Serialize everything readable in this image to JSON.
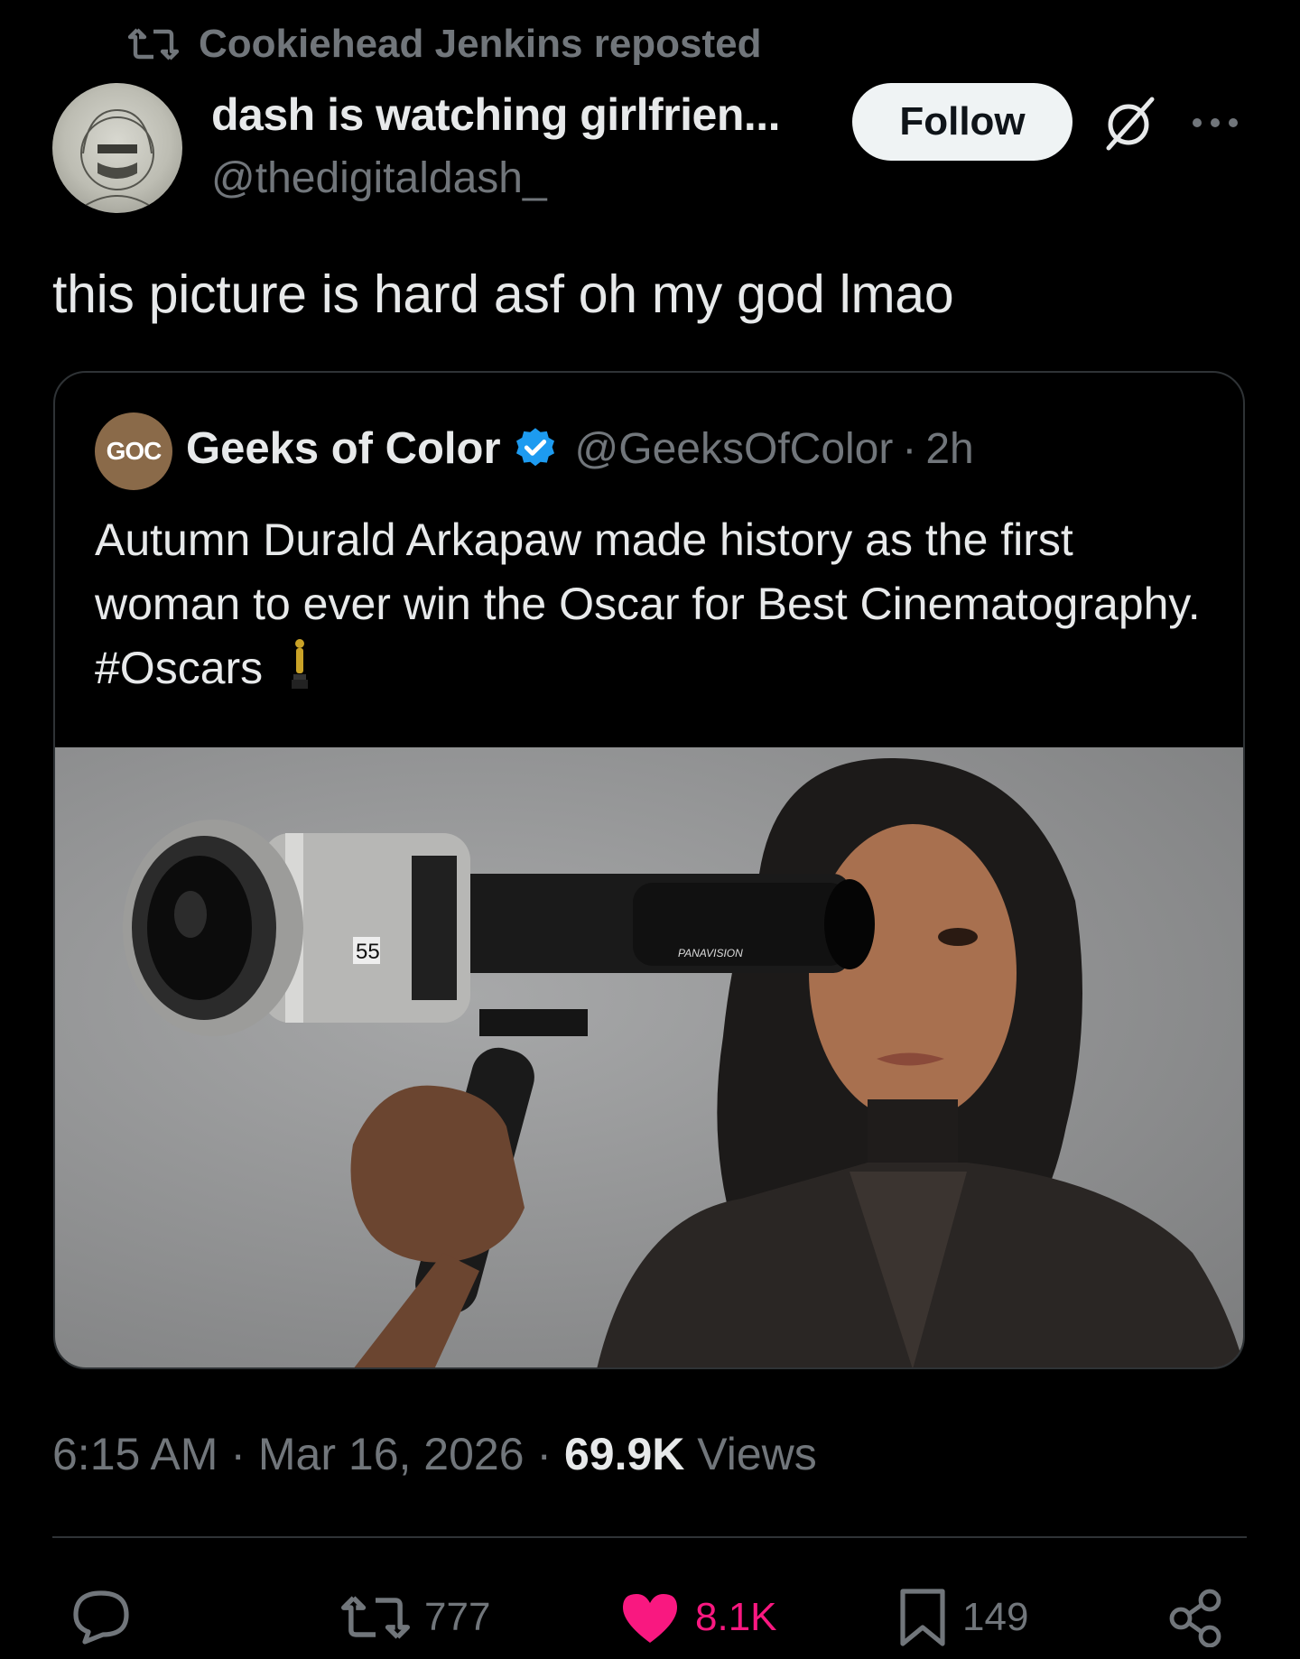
{
  "repost": {
    "icon": "repost-icon",
    "text": "Cookiehead Jenkins reposted"
  },
  "author": {
    "name": "dash is watching girlfrien...",
    "handle": "@thedigitaldash_",
    "follow_label": "Follow",
    "icons": [
      "grok-icon",
      "more-icon"
    ]
  },
  "tweet": {
    "text": "this picture is hard asf oh my god lmao"
  },
  "quoted": {
    "avatar_text": "GOC",
    "name": "Geeks of Color",
    "verified": true,
    "handle": "@GeeksOfColor",
    "separator": "·",
    "time": "2h",
    "text": "Autumn Durald Arkapaw made history as the first woman to ever win the Oscar for Best Cinematography. #Oscars",
    "emoji": "oscar-trophy-emoji",
    "image_lens_number": "55",
    "image_lens_brand": "PANAVISION"
  },
  "meta": {
    "time": "6:15 AM",
    "sep1": " · ",
    "date": "Mar 16, 2026",
    "sep2": " · ",
    "views_count": "69.9K",
    "views_label": " Views"
  },
  "actions": {
    "reply_count": "",
    "repost_count": "777",
    "like_count": "8.1K",
    "bookmark_count": "149"
  },
  "colors": {
    "background": "#000000",
    "text": "#e7e9ea",
    "muted": "#71767b",
    "like": "#f91880",
    "verified": "#1d9bf0",
    "follow_bg": "#eff3f4"
  }
}
